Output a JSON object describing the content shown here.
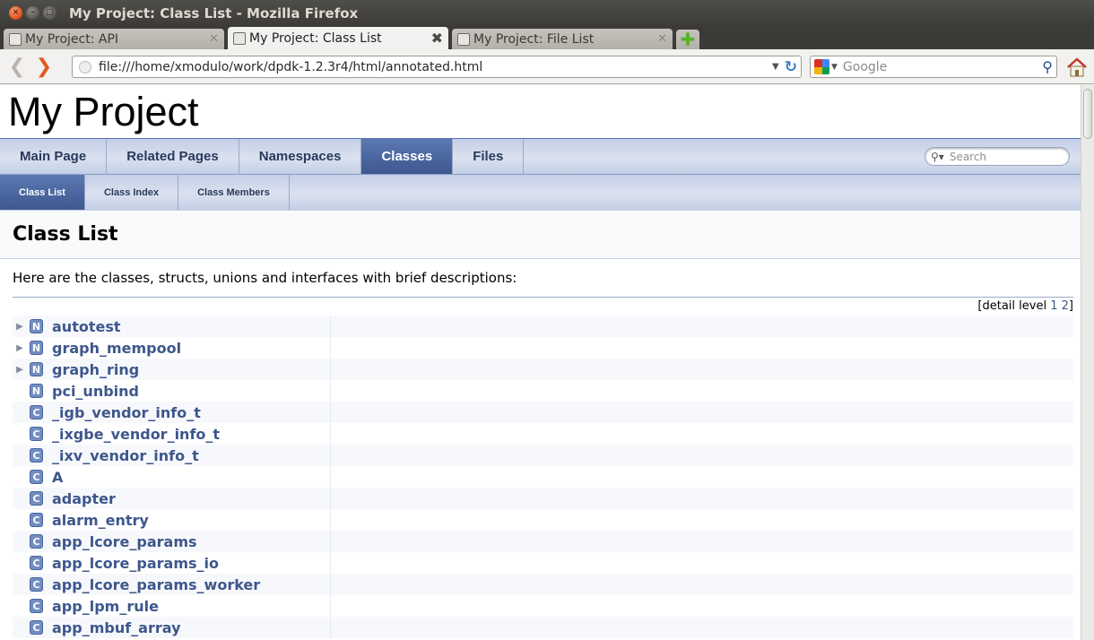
{
  "window": {
    "title": "My Project: Class List - Mozilla Firefox"
  },
  "tabs": [
    {
      "label": "My Project: API",
      "active": false
    },
    {
      "label": "My Project: Class List",
      "active": true
    },
    {
      "label": "My Project: File List",
      "active": false
    }
  ],
  "navbar": {
    "url": "file:///home/xmodulo/work/dpdk-1.2.3r4/html/annotated.html",
    "search_placeholder": "Google"
  },
  "page": {
    "project_title": "My Project",
    "main_tabs": [
      {
        "label": "Main Page",
        "selected": false
      },
      {
        "label": "Related Pages",
        "selected": false
      },
      {
        "label": "Namespaces",
        "selected": false
      },
      {
        "label": "Classes",
        "selected": true
      },
      {
        "label": "Files",
        "selected": false
      }
    ],
    "search_placeholder": "Search",
    "sub_tabs": [
      {
        "label": "Class List",
        "selected": true
      },
      {
        "label": "Class Index",
        "selected": false
      },
      {
        "label": "Class Members",
        "selected": false
      }
    ],
    "heading": "Class List",
    "intro": "Here are the classes, structs, unions and interfaces with brief descriptions:",
    "detail_level": {
      "prefix": "[detail level",
      "levels": [
        "1",
        "2"
      ],
      "suffix": "]"
    },
    "classes": [
      {
        "name": "autotest",
        "kind": "N",
        "expandable": true
      },
      {
        "name": "graph_mempool",
        "kind": "N",
        "expandable": true
      },
      {
        "name": "graph_ring",
        "kind": "N",
        "expandable": true
      },
      {
        "name": "pci_unbind",
        "kind": "N",
        "expandable": false
      },
      {
        "name": "_igb_vendor_info_t",
        "kind": "C",
        "expandable": false
      },
      {
        "name": "_ixgbe_vendor_info_t",
        "kind": "C",
        "expandable": false
      },
      {
        "name": "_ixv_vendor_info_t",
        "kind": "C",
        "expandable": false
      },
      {
        "name": "A",
        "kind": "C",
        "expandable": false
      },
      {
        "name": "adapter",
        "kind": "C",
        "expandable": false
      },
      {
        "name": "alarm_entry",
        "kind": "C",
        "expandable": false
      },
      {
        "name": "app_lcore_params",
        "kind": "C",
        "expandable": false
      },
      {
        "name": "app_lcore_params_io",
        "kind": "C",
        "expandable": false
      },
      {
        "name": "app_lcore_params_worker",
        "kind": "C",
        "expandable": false
      },
      {
        "name": "app_lpm_rule",
        "kind": "C",
        "expandable": false
      },
      {
        "name": "app_mbuf_array",
        "kind": "C",
        "expandable": false
      }
    ]
  },
  "colors": {
    "link": "#3d578c",
    "tab_selected": "#4a6aa5",
    "badge": "#728dc1"
  }
}
